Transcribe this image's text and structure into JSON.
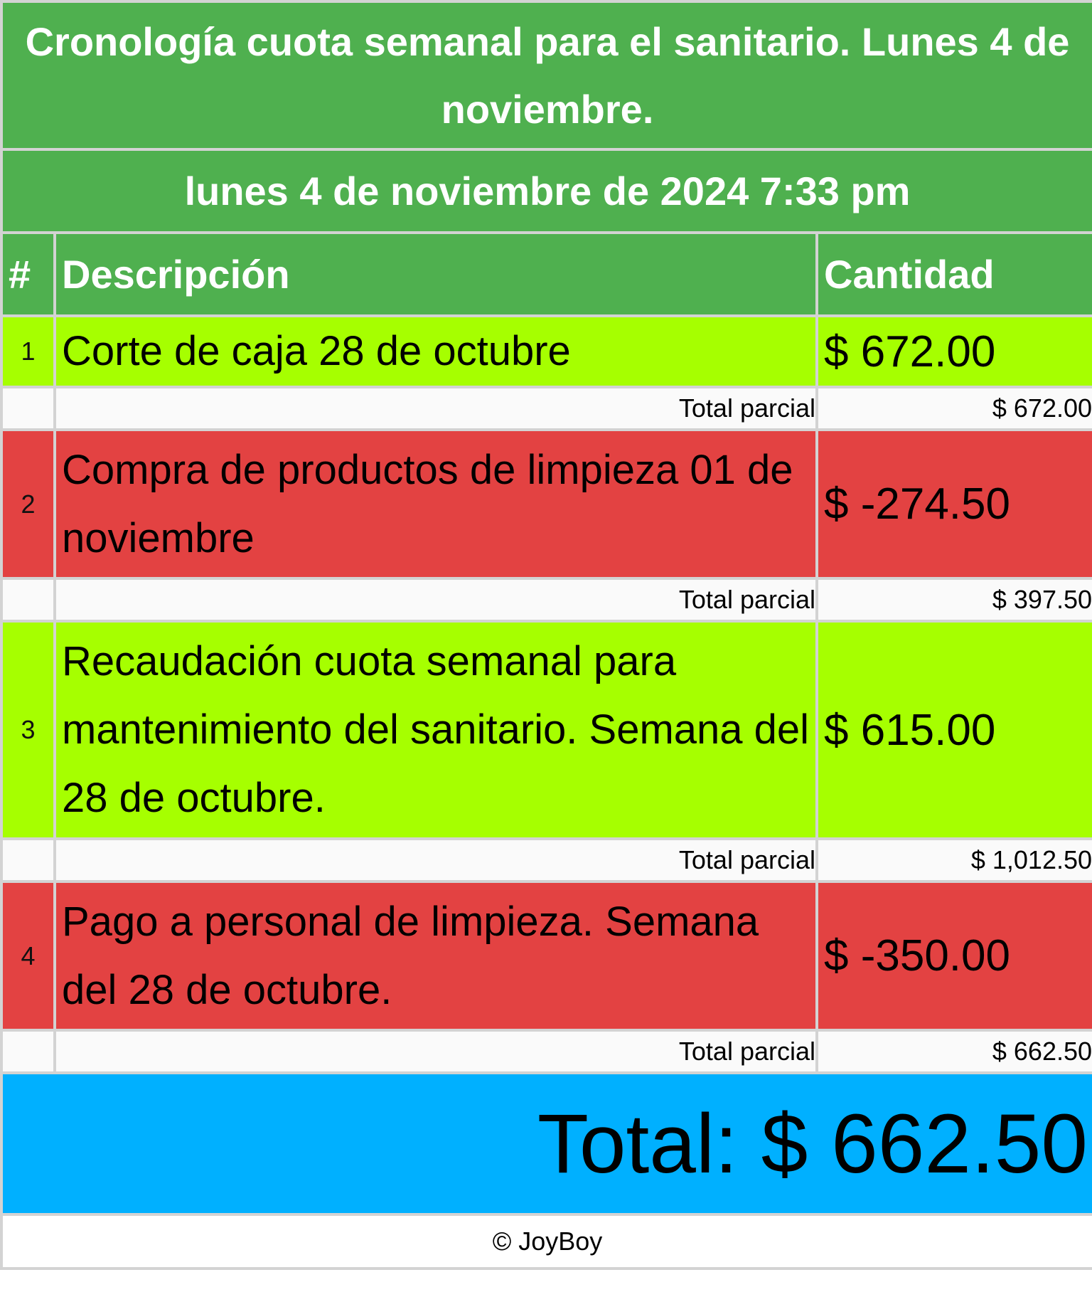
{
  "header": {
    "title": "Cronología cuota semanal para el sanitario. Lunes 4 de noviembre.",
    "date": "lunes 4 de noviembre de 2024 7:33 pm"
  },
  "columns": {
    "num": "#",
    "description": "Descripción",
    "amount": "Cantidad"
  },
  "rows": [
    {
      "num": "1",
      "description": "Corte de caja 28 de octubre",
      "amount": "$ 672.00",
      "subtotal_label": "Total parcial",
      "subtotal": "$ 672.00",
      "kind": "income"
    },
    {
      "num": "2",
      "description": "Compra de productos de limpieza 01 de noviembre",
      "amount": "$ -274.50",
      "subtotal_label": "Total parcial",
      "subtotal": "$ 397.50",
      "kind": "expense"
    },
    {
      "num": "3",
      "description": "Recaudación cuota semanal para mantenimiento del sanitario. Semana del 28 de octubre.",
      "amount": "$ 615.00",
      "subtotal_label": "Total parcial",
      "subtotal": "$ 1,012.50",
      "kind": "income"
    },
    {
      "num": "4",
      "description": "Pago a personal de limpieza. Semana del 28 de octubre.",
      "amount": "$ -350.00",
      "subtotal_label": "Total parcial",
      "subtotal": "$ 662.50",
      "kind": "expense"
    }
  ],
  "total": "Total: $ 662.50",
  "footer": "© JoyBoy",
  "colors": {
    "header_green": "#4fb04f",
    "income_green": "#a6ff00",
    "expense_red": "#e34242",
    "total_blue": "#00b0ff",
    "border_gray": "#d3d3d3"
  }
}
